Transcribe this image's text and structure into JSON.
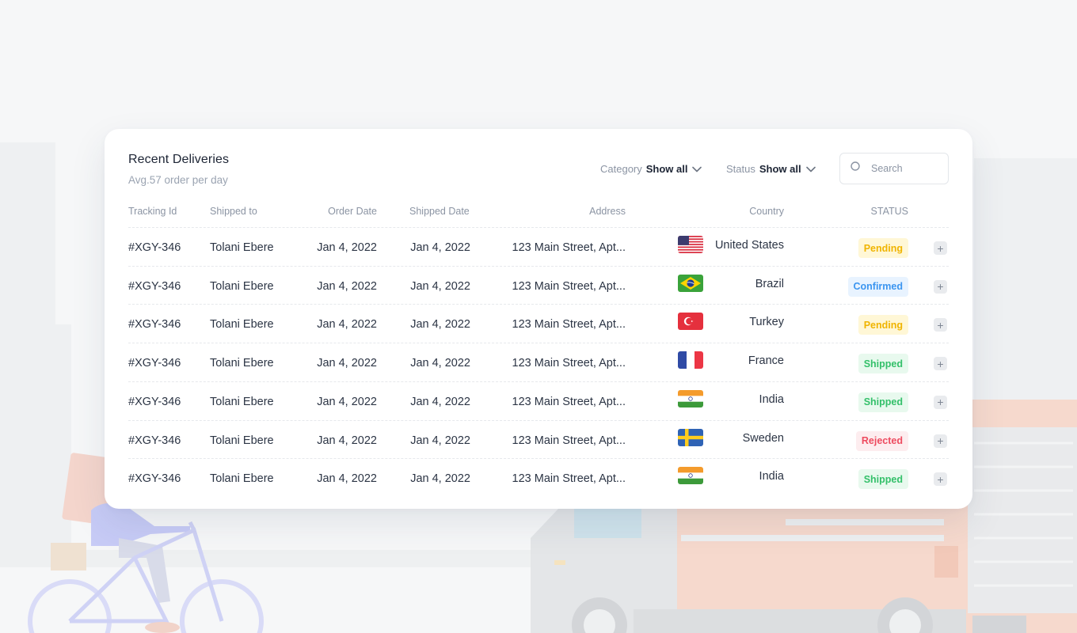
{
  "card": {
    "title": "Recent Deliveries",
    "subtitle": "Avg.57 order per day"
  },
  "filters": {
    "category_label": "Category",
    "category_value": "Show all",
    "status_label": "Status",
    "status_value": "Show all"
  },
  "search": {
    "placeholder": "Search"
  },
  "columns": [
    "Tracking Id",
    "Shipped to",
    "Order Date",
    "Shipped Date",
    "Address",
    "Country",
    "STATUS"
  ],
  "rows": [
    {
      "tracking": "#XGY-346",
      "name": "Tolani Ebere",
      "order_date": "Jan 4, 2022",
      "shipped_date": "Jan 4, 2022",
      "address": "123 Main Street, Apt...",
      "country": "United States",
      "flag": "us",
      "status": "Pending"
    },
    {
      "tracking": "#XGY-346",
      "name": "Tolani Ebere",
      "order_date": "Jan 4, 2022",
      "shipped_date": "Jan 4, 2022",
      "address": "123 Main Street, Apt...",
      "country": "Brazil",
      "flag": "br",
      "status": "Confirmed"
    },
    {
      "tracking": "#XGY-346",
      "name": "Tolani Ebere",
      "order_date": "Jan 4, 2022",
      "shipped_date": "Jan 4, 2022",
      "address": "123 Main Street, Apt...",
      "country": "Turkey",
      "flag": "tr",
      "status": "Pending"
    },
    {
      "tracking": "#XGY-346",
      "name": "Tolani Ebere",
      "order_date": "Jan 4, 2022",
      "shipped_date": "Jan 4, 2022",
      "address": "123 Main Street, Apt...",
      "country": "France",
      "flag": "fr",
      "status": "Shipped"
    },
    {
      "tracking": "#XGY-346",
      "name": "Tolani Ebere",
      "order_date": "Jan 4, 2022",
      "shipped_date": "Jan 4, 2022",
      "address": "123 Main Street, Apt...",
      "country": "India",
      "flag": "in",
      "status": "Shipped"
    },
    {
      "tracking": "#XGY-346",
      "name": "Tolani Ebere",
      "order_date": "Jan 4, 2022",
      "shipped_date": "Jan 4, 2022",
      "address": "123 Main Street, Apt...",
      "country": "Sweden",
      "flag": "se",
      "status": "Rejected"
    },
    {
      "tracking": "#XGY-346",
      "name": "Tolani Ebere",
      "order_date": "Jan 4, 2022",
      "shipped_date": "Jan 4, 2022",
      "address": "123 Main Street, Apt...",
      "country": "India",
      "flag": "in",
      "status": "Shipped"
    }
  ],
  "status_colors": {
    "Pending": {
      "bg": "#fff7d6",
      "fg": "#f0b400"
    },
    "Confirmed": {
      "bg": "#e8f3ff",
      "fg": "#3b95f0"
    },
    "Shipped": {
      "bg": "#e8f9ee",
      "fg": "#34c06a"
    },
    "Rejected": {
      "bg": "#fdedef",
      "fg": "#ee4b5f"
    }
  },
  "icons": {
    "search": "search-icon",
    "chevron": "chevron-down-icon",
    "plus": "plus-icon"
  }
}
